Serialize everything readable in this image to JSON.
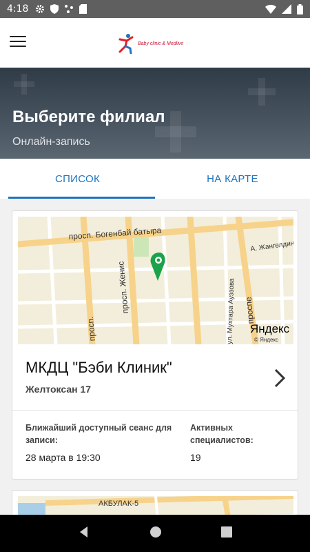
{
  "status_bar": {
    "time": "4:18",
    "icons": [
      "gear-icon",
      "shield-icon",
      "dots-icon",
      "sd-card-icon",
      "wifi-icon",
      "signal-icon",
      "battery-icon"
    ]
  },
  "app_bar": {
    "menu_icon": "hamburger-icon",
    "logo_text": "Baby clinic & Medlive"
  },
  "hero": {
    "title": "Выберите филиал",
    "subtitle": "Онлайн-запись"
  },
  "tabs": [
    {
      "label": "СПИСОК",
      "active": true
    },
    {
      "label": "НА КАРТЕ",
      "active": false
    }
  ],
  "branches": [
    {
      "name": "МКДЦ \"Бэби Клиник\"",
      "address": "Желтоксан 17",
      "nearest_label": "Ближайший доступный сеанс для записи:",
      "nearest_value": "28 марта в 19:30",
      "specialists_label": "Активных специалистов:",
      "specialists_value": "19",
      "map": {
        "streets": [
          "просп. Богенбай батыра",
          "просп. Женис",
          "просп.",
          "А. Жангелдин",
          "ул. Мухтара Ауэзова",
          "проспе"
        ],
        "brand": "Яндекс",
        "copyright": "© Яндекс"
      }
    },
    {
      "map": {
        "streets": [
          "АКБУЛАК-5"
        ]
      }
    }
  ],
  "colors": {
    "accent": "#1e73be",
    "status_bar": "#5f5f5f",
    "map_pin": "#1aa34a"
  }
}
